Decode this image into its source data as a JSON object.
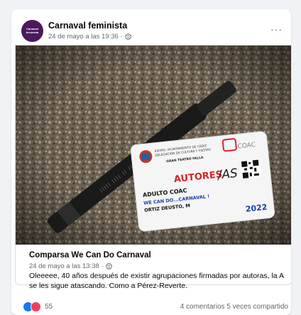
{
  "post": {
    "page_name": "Carnaval feminista",
    "avatar_text": "Carnaval feminista",
    "timestamp": "24 de mayo a las 19:36 ·",
    "more_label": "···"
  },
  "card": {
    "institution_line1": "EXCMO. AYUNTAMIENTO DE CÁDIZ",
    "institution_line2": "DELEGACIÓN DE CULTURA Y FIESTAS",
    "venue": "GRAN TEATRO FALLA",
    "coac_logo": "COAC",
    "category": "AUTORES",
    "category_handwritten": "/AS",
    "pass_type": "ADULTO COAC",
    "group_name": "WE CAN DO...CARNAVAL !",
    "holder": "ORTIZ DEUSTO, M",
    "year": "2022"
  },
  "link_preview": {
    "title": "Comparsa We Can Do Carnaval",
    "timestamp": "24 de mayo a las 13:38 ·",
    "text": "Oleeeee, 40 años después de existir agrupaciones firmadas por autoras, la A se les sigue atascando. Como a Pérez-Reverte."
  },
  "footer": {
    "reaction_count": "55",
    "stats": "4 comentarios  5 veces compartido"
  },
  "colors": {
    "accent": "#1877f2",
    "avatar_bg": "#4a1a5c",
    "card_red": "#d8232a",
    "card_blue": "#1b3fa8"
  }
}
